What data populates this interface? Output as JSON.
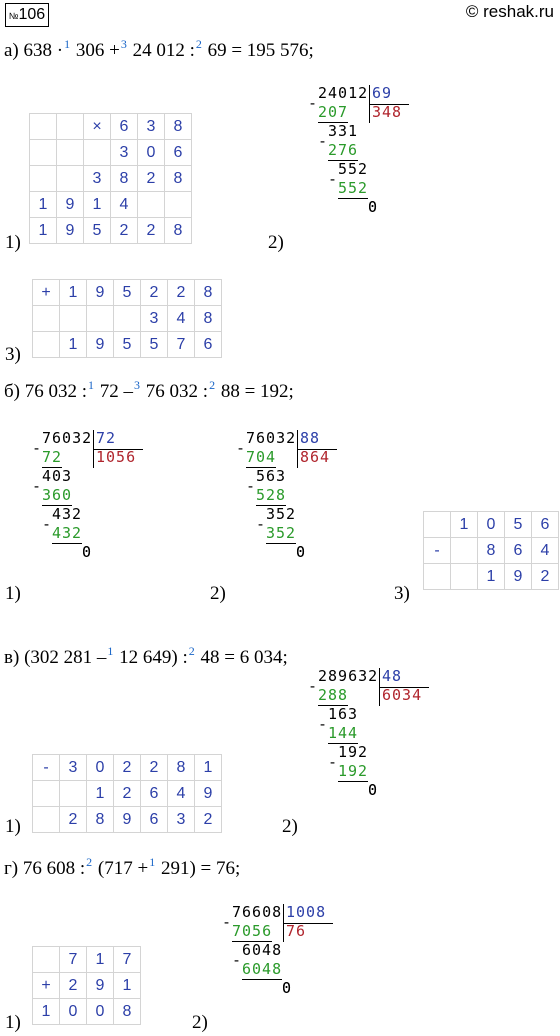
{
  "header": {
    "number_prefix": "№",
    "number": "106",
    "site": "© reshak.ru"
  },
  "a": {
    "letter": "а)",
    "expr": [
      {
        "t": "638 ·"
      },
      {
        "s": "1"
      },
      {
        "t": " 306 +"
      },
      {
        "s": "3"
      },
      {
        "t": " 24 012 :"
      },
      {
        "s": "2"
      },
      {
        "t": " 69 = 195 576;"
      }
    ],
    "step1_label": "1)",
    "step1_rows": [
      [
        "",
        "",
        "×",
        "6",
        "3",
        "8"
      ],
      [
        "",
        "",
        "",
        "3",
        "0",
        "6"
      ],
      [
        "",
        "",
        "3",
        "8",
        "2",
        "8"
      ],
      [
        "1",
        "9",
        "1",
        "4",
        "",
        ""
      ],
      [
        "1",
        "9",
        "5",
        "2",
        "2",
        "8"
      ]
    ],
    "step2_label": "2)",
    "step2_div": {
      "dividend": "24012",
      "divisor": "69",
      "quotient": "348",
      "lines": [
        "207",
        "331",
        "276",
        "552",
        "552",
        "0"
      ]
    },
    "step3_label": "3)",
    "step3_rows": [
      [
        "+",
        "1",
        "9",
        "5",
        "2",
        "2",
        "8"
      ],
      [
        "",
        "",
        "",
        "",
        "3",
        "4",
        "8"
      ],
      [
        "",
        "1",
        "9",
        "5",
        "5",
        "7",
        "6"
      ]
    ]
  },
  "b": {
    "letter": "б)",
    "expr": [
      {
        "t": "76 032 :"
      },
      {
        "s": "1"
      },
      {
        "t": " 72 –"
      },
      {
        "s": "3"
      },
      {
        "t": " 76 032 :"
      },
      {
        "s": "2"
      },
      {
        "t": " 88 = 192;"
      }
    ],
    "step1_label": "1)",
    "step1_div": {
      "dividend": "76032",
      "divisor": "72",
      "quotient": "1056",
      "lines": [
        "72",
        "403",
        "360",
        "432",
        "432",
        "0"
      ]
    },
    "step2_label": "2)",
    "step2_div": {
      "dividend": "76032",
      "divisor": "88",
      "quotient": "864",
      "lines": [
        "704",
        "563",
        "528",
        "352",
        "352",
        "0"
      ]
    },
    "step3_label": "3)",
    "step3_rows": [
      [
        "",
        "1",
        "0",
        "5",
        "6"
      ],
      [
        "-",
        "",
        "8",
        "6",
        "4"
      ],
      [
        "",
        "",
        "1",
        "9",
        "2"
      ]
    ]
  },
  "v": {
    "letter": "в)",
    "expr": [
      {
        "t": "(302 281 –"
      },
      {
        "s": "1"
      },
      {
        "t": " 12 649) :"
      },
      {
        "s": "2"
      },
      {
        "t": " 48 = 6 034;"
      }
    ],
    "step1_label": "1)",
    "step1_rows": [
      [
        "-",
        "3",
        "0",
        "2",
        "2",
        "8",
        "1"
      ],
      [
        "",
        "",
        "1",
        "2",
        "6",
        "4",
        "9"
      ],
      [
        "",
        "2",
        "8",
        "9",
        "6",
        "3",
        "2"
      ]
    ],
    "step2_label": "2)",
    "step2_div": {
      "dividend": "289632",
      "divisor": "48",
      "quotient": "6034",
      "lines": [
        "288",
        "163",
        "144",
        "192",
        "192",
        "0"
      ]
    }
  },
  "g": {
    "letter": "г)",
    "expr": [
      {
        "t": "76 608 :"
      },
      {
        "s": "2"
      },
      {
        "t": " (717 +"
      },
      {
        "s": "1"
      },
      {
        "t": " 291) = 76;"
      }
    ],
    "step1_label": "1)",
    "step1_rows": [
      [
        "",
        "7",
        "1",
        "7"
      ],
      [
        "+",
        "2",
        "9",
        "1"
      ],
      [
        "1",
        "0",
        "0",
        "8"
      ]
    ],
    "step2_label": "2)",
    "step2_div": {
      "dividend": "76608",
      "divisor": "1008",
      "quotient": "76",
      "lines": [
        "7056",
        "6048",
        "6048",
        "0"
      ]
    }
  },
  "colors": {
    "blue": "#2c3fa8",
    "green": "#2a9a2a",
    "red": "#b0252d",
    "superscript": "#1a66c8"
  }
}
